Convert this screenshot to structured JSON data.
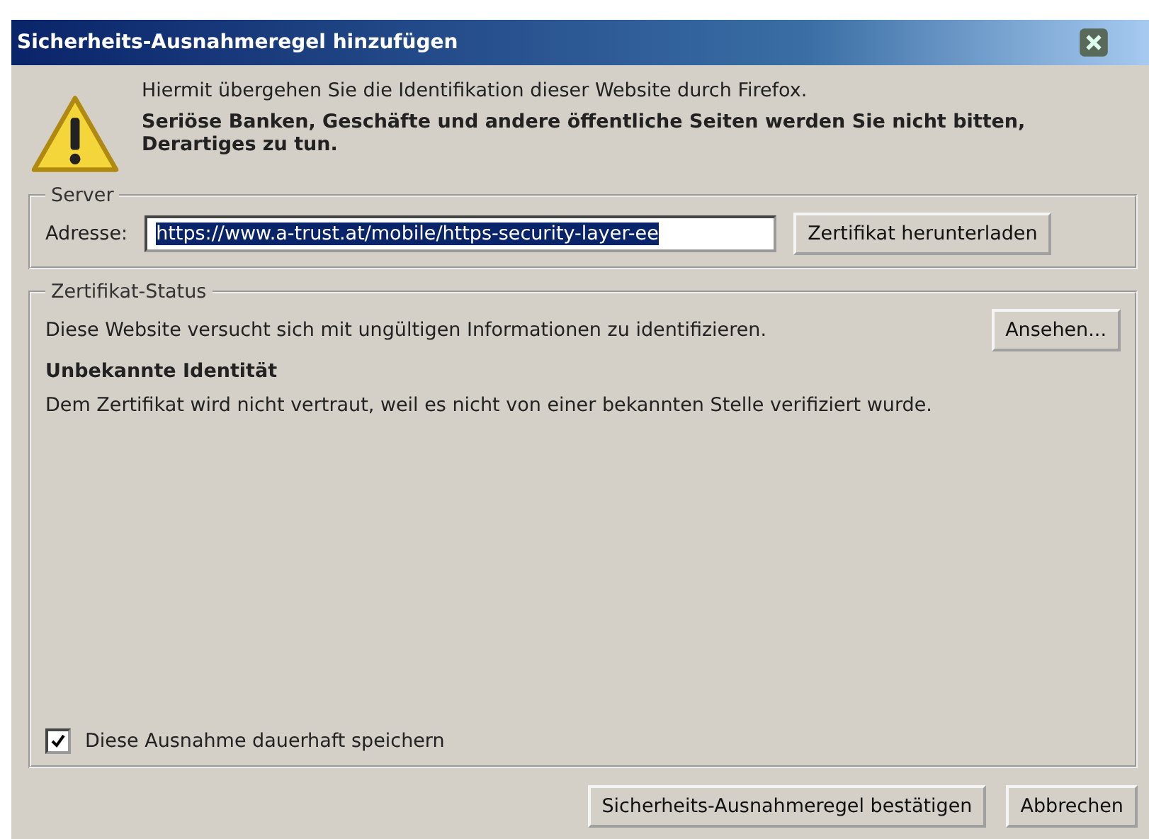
{
  "window": {
    "title": "Sicherheits-Ausnahmeregel hinzufügen"
  },
  "intro": {
    "line": "Hiermit übergehen Sie die Identifikation dieser Website durch Firefox.",
    "warning": "Seriöse Banken, Geschäfte und andere öffentliche Seiten werden Sie nicht bitten, Derartiges zu tun."
  },
  "server": {
    "legend": "Server",
    "address_label": "Adresse:",
    "address_value": "https://www.a-trust.at/mobile/https-security-layer-ee",
    "address_selected": true,
    "download_button": "Zertifikat herunterladen"
  },
  "status": {
    "legend": "Zertifikat-Status",
    "message": "Diese Website versucht sich mit ungültigen Informationen zu identifizieren.",
    "view_button": "Ansehen...",
    "heading": "Unbekannte Identität",
    "detail": "Dem Zertifikat wird nicht vertraut, weil es nicht von einer bekannten Stelle verifiziert wurde."
  },
  "permanent": {
    "label": "Diese Ausnahme dauerhaft speichern",
    "checked": true
  },
  "buttons": [
    "Sicherheits-Ausnahmeregel bestätigen",
    "Abbrechen"
  ]
}
